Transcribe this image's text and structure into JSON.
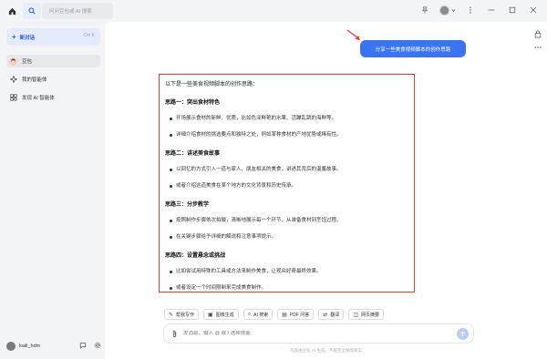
{
  "topbar": {
    "search_placeholder": "问问豆包或 AI 搜索"
  },
  "sidebar": {
    "new_chat_label": "新对话",
    "new_chat_shortcut": "Ctrl K",
    "items": [
      {
        "label": "豆包",
        "active": true
      },
      {
        "label": "我的智能体",
        "active": false
      },
      {
        "label": "发现 AI 智能体",
        "active": false
      }
    ],
    "user_name": "kaili_hdm"
  },
  "conversation": {
    "user_message": "分享一些美食视频脚本的创作思路",
    "response_intro": "以下是一些美食视频脚本的创作思路：",
    "sections": [
      {
        "title": "思路一：突出食材特色",
        "bullets": [
          "开场展示食材的新鲜、优质，比如色泽鲜艳的水果、活蹦乱跳的海鲜等。",
          "详细介绍食材的挑选要点和独特之处，例如某种食材的产地优势或稀有性。"
        ]
      },
      {
        "title": "思路二：讲述美食故事",
        "bullets": [
          "以回忆的方式引入一道与家人、朋友相关的美食，讲述其背后的温馨故事。",
          "或者介绍这道美食在某个地方的文化背景和历史传承。"
        ]
      },
      {
        "title": "思路三：分步教学",
        "bullets": [
          "按照制作步骤依次拍摄，清晰地展示每一个环节，从准备食材到烹饪过程。",
          "在关键步骤给予详细的解说和注意事项提示。"
        ]
      },
      {
        "title": "思路四：设置悬念或挑战",
        "bullets": [
          "比如尝试用特殊的工具或方法来制作美食，让观众好奇最终效果。",
          "或者设定一个时间限制来完成美食制作。"
        ]
      }
    ]
  },
  "toolbar": {
    "chips": [
      {
        "label": "帮我写作",
        "icon": "pen-icon"
      },
      {
        "label": "图像生成",
        "icon": "image-icon"
      },
      {
        "label": "AI 搜索",
        "icon": "search-icon"
      },
      {
        "label": "PDF 问答",
        "icon": "pdf-icon"
      },
      {
        "label": "翻译",
        "icon": "translate-icon"
      },
      {
        "label": "网页摘要",
        "icon": "web-icon"
      }
    ]
  },
  "composer": {
    "placeholder": "发消息、输入 @ 或 / 选择技能"
  },
  "footer": {
    "disclaimer": "内容由豆包 AI 生成，不能完全保障真实"
  },
  "colors": {
    "accent": "#3a74f2",
    "annotation_red": "#e53935"
  }
}
